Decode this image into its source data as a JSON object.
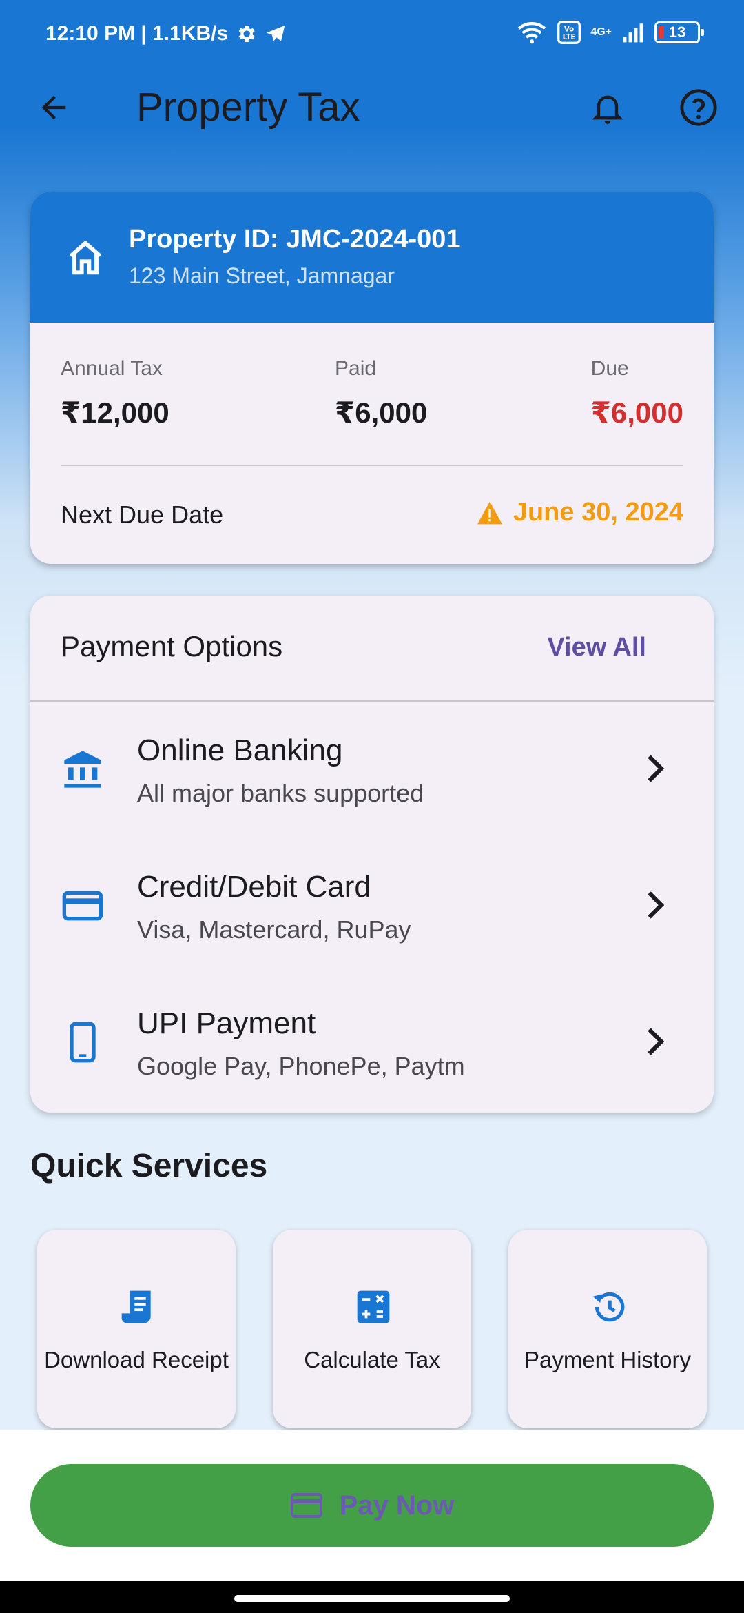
{
  "status_bar": {
    "time": "12:10 PM | 1.1KB/s",
    "network": "4G+",
    "battery": "13"
  },
  "app_bar": {
    "title": "Property Tax"
  },
  "property": {
    "id_label": "Property ID: JMC-2024-001",
    "address": "123 Main Street, Jamnagar",
    "annual_tax_label": "Annual Tax",
    "annual_tax_value": "₹12,000",
    "paid_label": "Paid",
    "paid_value": "₹6,000",
    "due_label": "Due",
    "due_value": "₹6,000",
    "next_due_label": "Next Due Date",
    "next_due_value": "June 30, 2024"
  },
  "payment_options": {
    "title": "Payment Options",
    "view_all": "View All",
    "items": [
      {
        "name": "Online Banking",
        "sub": "All major banks supported",
        "icon": "bank-icon"
      },
      {
        "name": "Credit/Debit Card",
        "sub": "Visa, Mastercard, RuPay",
        "icon": "credit-card-icon"
      },
      {
        "name": "UPI Payment",
        "sub": "Google Pay, PhonePe, Paytm",
        "icon": "smartphone-icon"
      }
    ]
  },
  "quick_services": {
    "title": "Quick Services",
    "items": [
      {
        "label": "Download Receipt",
        "icon": "receipt-icon"
      },
      {
        "label": "Calculate Tax",
        "icon": "calculator-icon"
      },
      {
        "label": "Payment History",
        "icon": "history-icon"
      }
    ]
  },
  "bottom": {
    "pay_now": "Pay Now"
  },
  "colors": {
    "primary": "#1976d2",
    "due_red": "#d32f2f",
    "warning_orange": "#f39c12",
    "pay_green": "#43a047",
    "accent_purple": "#5e4fa2"
  }
}
